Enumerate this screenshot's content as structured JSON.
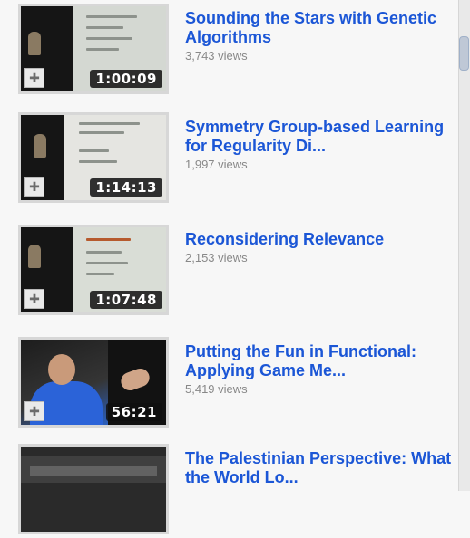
{
  "videos": [
    {
      "title": "Sounding the Stars with Genetic Algorithms",
      "views": "3,743 views",
      "duration": "1:00:09"
    },
    {
      "title": "Symmetry Group-based Learning for Regularity Di...",
      "views": "1,997 views",
      "duration": "1:14:13"
    },
    {
      "title": "Reconsidering Relevance",
      "views": "2,153 views",
      "duration": "1:07:48"
    },
    {
      "title": "Putting the Fun in Functional: Applying Game Me...",
      "views": "5,419 views",
      "duration": "56:21"
    },
    {
      "title": "The Palestinian Perspective: What the World Lo...",
      "views": "",
      "duration": ""
    }
  ],
  "icons": {
    "thumb_badge": "quicklist-add-icon"
  },
  "colors": {
    "title_link": "#1b56d6",
    "views_text": "#888888",
    "page_background": "#f7f7f7"
  }
}
